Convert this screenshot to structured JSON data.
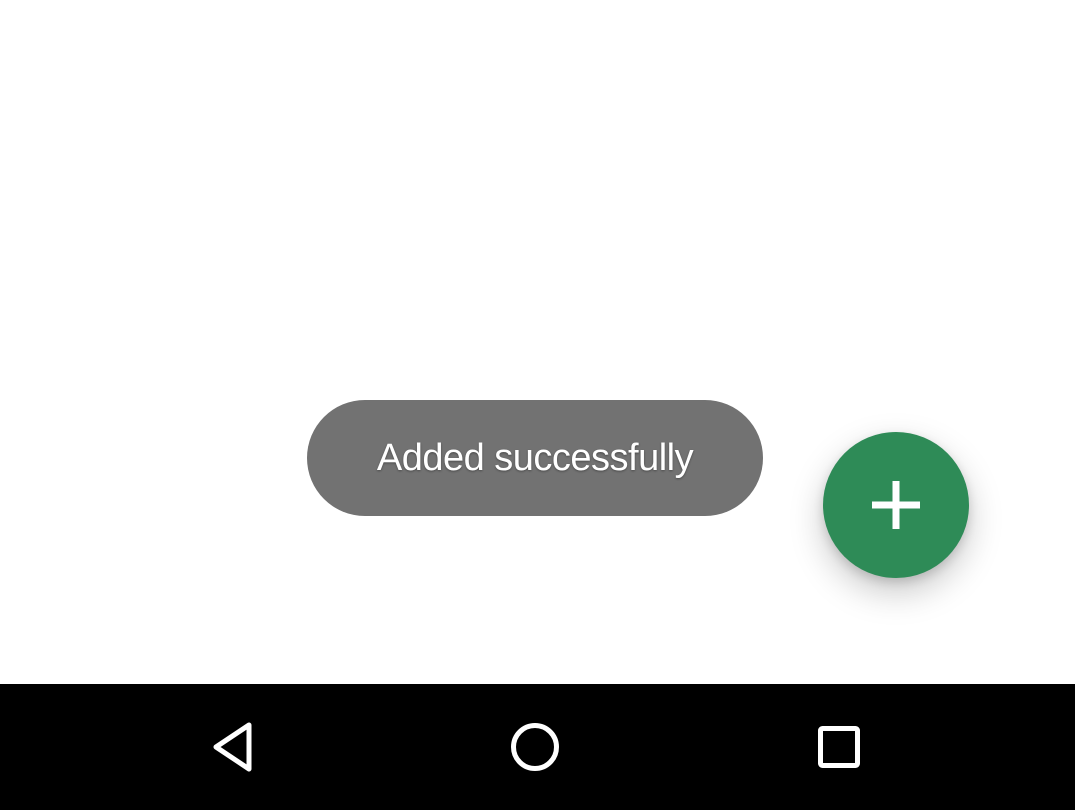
{
  "toast": {
    "message": "Added successfully"
  },
  "fab": {
    "icon": "plus-icon",
    "color": "#2e8b57",
    "action": "add"
  },
  "navigation_bar": {
    "buttons": [
      {
        "icon": "back-triangle-icon",
        "action": "back"
      },
      {
        "icon": "home-circle-icon",
        "action": "home"
      },
      {
        "icon": "recents-square-icon",
        "action": "recents"
      }
    ]
  },
  "colors": {
    "background": "#ffffff",
    "toast_background": "#727272",
    "toast_text": "#ffffff",
    "fab_background": "#2e8b57",
    "navbar_background": "#000000",
    "navbar_icons": "#ffffff"
  }
}
